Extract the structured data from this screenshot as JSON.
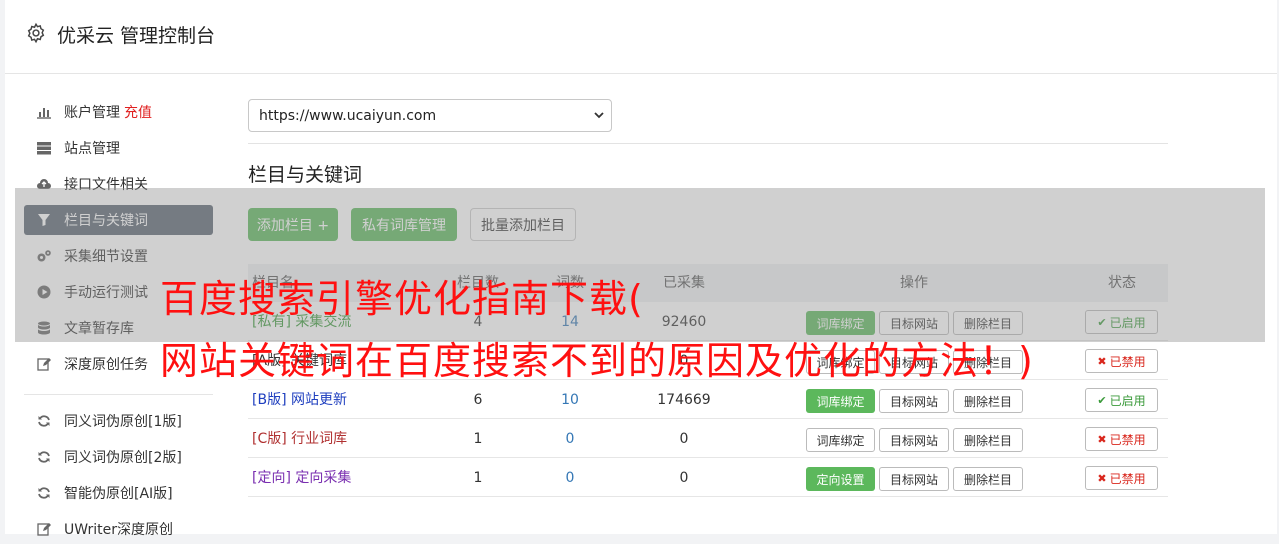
{
  "app": {
    "title": "优采云 管理控制台"
  },
  "sidebar": {
    "items": [
      {
        "label": "账户管理",
        "extra": "充值",
        "icon": "bar-chart-icon"
      },
      {
        "label": "站点管理",
        "icon": "server-icon"
      },
      {
        "label": "接口文件相关",
        "icon": "cloud-upload-icon"
      },
      {
        "label": "栏目与关键词",
        "icon": "filter-icon",
        "active": true
      },
      {
        "label": "采集细节设置",
        "icon": "cogs-icon"
      },
      {
        "label": "手动运行测试",
        "icon": "play-circle-icon"
      },
      {
        "label": "文章暂存库",
        "icon": "database-icon"
      },
      {
        "label": "深度原创任务",
        "icon": "edit-icon"
      },
      {
        "label": "同义词伪原创[1版]",
        "icon": "refresh-icon"
      },
      {
        "label": "同义词伪原创[2版]",
        "icon": "refresh-icon"
      },
      {
        "label": "智能伪原创[AI版]",
        "icon": "refresh-icon"
      },
      {
        "label": "UWriter深度原创",
        "icon": "edit-icon"
      }
    ]
  },
  "main": {
    "site_select_value": "https://www.ucaiyun.com",
    "section_title": "栏目与关键词",
    "toolbar": {
      "add_column": "添加栏目 +",
      "private_lib": "私有词库管理",
      "batch_add": "批量添加栏目"
    },
    "table": {
      "headers": {
        "name": "栏目名",
        "columns": "栏目数",
        "keywords": "词数",
        "collected": "已采集",
        "actions": "操作",
        "status": "状态"
      },
      "rows": [
        {
          "tag": "[私有]",
          "name": "采集交流",
          "color": "#3a9a3a",
          "a": "4",
          "b": "14",
          "c": "92460",
          "bind_label": "词库绑定",
          "bind_green": true,
          "status": "已启用",
          "on": true
        },
        {
          "tag": "[A版]",
          "name": "关键词库",
          "color": "#333333",
          "a": "",
          "b": "",
          "c": "0",
          "bind_label": "词库绑定",
          "bind_green": false,
          "status": "已禁用",
          "on": false
        },
        {
          "tag": "[B版]",
          "name": "网站更新",
          "color": "#1f3fbf",
          "a": "6",
          "b": "10",
          "c": "174669",
          "bind_label": "词库绑定",
          "bind_green": true,
          "status": "已启用",
          "on": true
        },
        {
          "tag": "[C版]",
          "name": "行业词库",
          "color": "#b03030",
          "a": "1",
          "b": "0",
          "c": "0",
          "bind_label": "词库绑定",
          "bind_green": false,
          "status": "已禁用",
          "on": false
        },
        {
          "tag": "[定向]",
          "name": "定向采集",
          "color": "#7a2fb0",
          "a": "1",
          "b": "0",
          "c": "0",
          "bind_label": "定向设置",
          "bind_green": true,
          "status": "已禁用",
          "on": false
        }
      ],
      "target_site": "目标网站",
      "delete_column": "删除栏目"
    }
  },
  "overlay": {
    "line1": "百度搜索引擎优化指南下载(",
    "line2": "网站关键词在百度搜索不到的原因及优化的方法！)"
  },
  "colors": {
    "accent_green": "#5cb85c",
    "active_sidebar": "#5a6472",
    "headline_red": "#ff1010"
  }
}
